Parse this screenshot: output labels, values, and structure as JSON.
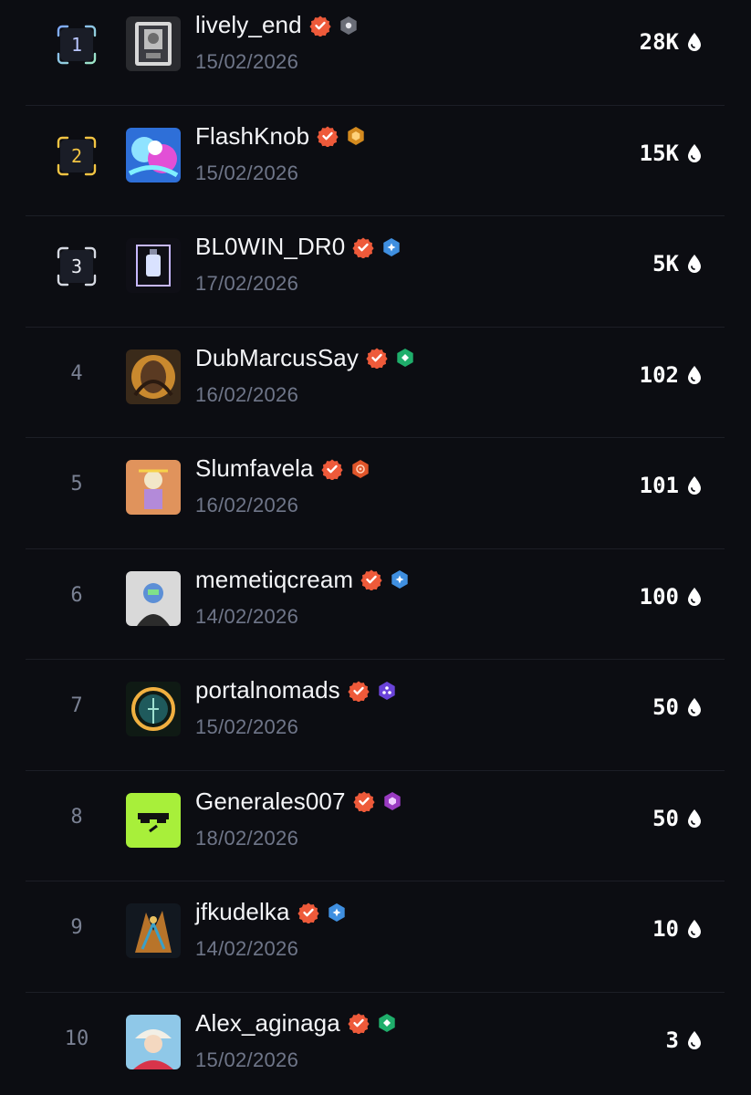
{
  "leaderboard": {
    "rows": [
      {
        "rank": "1",
        "name": "lively_end",
        "date": "15/02/2026",
        "score": "28K",
        "badge_color": "#6b6e78",
        "rank_style": "frame",
        "frame_colors": [
          "#7ea8ff",
          "#9ee7c6"
        ]
      },
      {
        "rank": "2",
        "name": "FlashKnob",
        "date": "15/02/2026",
        "score": "15K",
        "badge_color": "#d48a1e",
        "rank_style": "frame",
        "frame_colors": [
          "#f2c443",
          "#f2c443"
        ]
      },
      {
        "rank": "3",
        "name": "BL0WIN_DR0",
        "date": "17/02/2026",
        "score": "5K",
        "badge_color": "#3f8fe0",
        "rank_style": "frame",
        "frame_colors": [
          "#d6d9e2",
          "#d6d9e2"
        ]
      },
      {
        "rank": "4",
        "name": "DubMarcusSay",
        "date": "16/02/2026",
        "score": "102",
        "badge_color": "#1fae6b",
        "rank_style": "plain"
      },
      {
        "rank": "5",
        "name": "Slumfavela",
        "date": "16/02/2026",
        "score": "101",
        "badge_color": "#e0552a",
        "rank_style": "plain"
      },
      {
        "rank": "6",
        "name": "memetiqcream",
        "date": "14/02/2026",
        "score": "100",
        "badge_color": "#3f8fe0",
        "rank_style": "plain"
      },
      {
        "rank": "7",
        "name": "portalnomads",
        "date": "15/02/2026",
        "score": "50",
        "badge_color": "#6a43d8",
        "rank_style": "plain"
      },
      {
        "rank": "8",
        "name": "Generales007",
        "date": "18/02/2026",
        "score": "50",
        "badge_color": "#9a3bc2",
        "rank_style": "plain"
      },
      {
        "rank": "9",
        "name": "jfkudelka",
        "date": "14/02/2026",
        "score": "10",
        "badge_color": "#3f8fe0",
        "rank_style": "plain"
      },
      {
        "rank": "10",
        "name": "Alex_aginaga",
        "date": "15/02/2026",
        "score": "3",
        "badge_color": "#1fae6b",
        "rank_style": "plain"
      }
    ],
    "verified_color": "#ee5a3a",
    "score_icon": "droplet-icon",
    "verified_icon": "verified-check-icon"
  }
}
